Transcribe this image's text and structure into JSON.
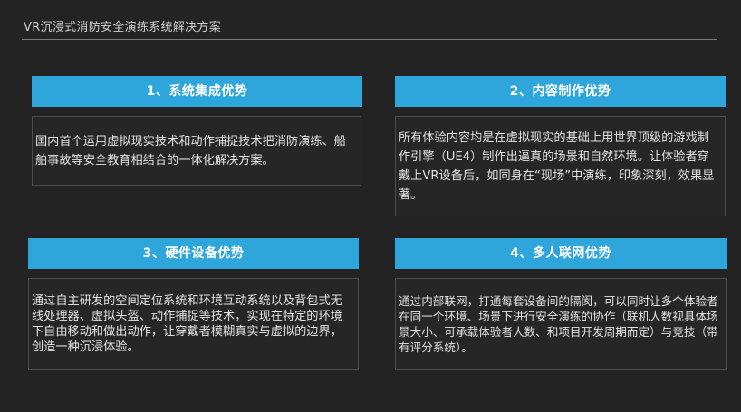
{
  "page": {
    "title": "VR沉浸式消防安全演练系统解决方案"
  },
  "sections": [
    {
      "heading": "1、系统集成优势",
      "body": "国内首个运用虚拟现实技术和动作捕捉技术把消防演练、船舶事故等安全教育相结合的一体化解决方案。"
    },
    {
      "heading": "2、内容制作优势",
      "body": "所有体验内容均是在虚拟现实的基础上用世界顶级的游戏制作引擎（UE4）制作出逼真的场景和自然环境。让体验者穿戴上VR设备后，如同身在“现场”中演练，印象深刻，效果显著。"
    },
    {
      "heading": "3、硬件设备优势",
      "body": "通过自主研发的空间定位系统和环境互动系统以及背包式无线处理器、虚拟头盔、动作捕捉等技术，实现在特定的环境下自由移动和做出动作，让穿戴者模糊真实与虚拟的边界，创造一种沉浸体验。"
    },
    {
      "heading": "4、多人联网优势",
      "body": "通过内部联网，打通每套设备间的隔阂，可以同时让多个体验者在同一个环境、场景下进行安全演练的协作（联机人数视具体场景大小、可承载体验者人数、和项目开发周期而定）与竞技（带有评分系统）。"
    }
  ]
}
